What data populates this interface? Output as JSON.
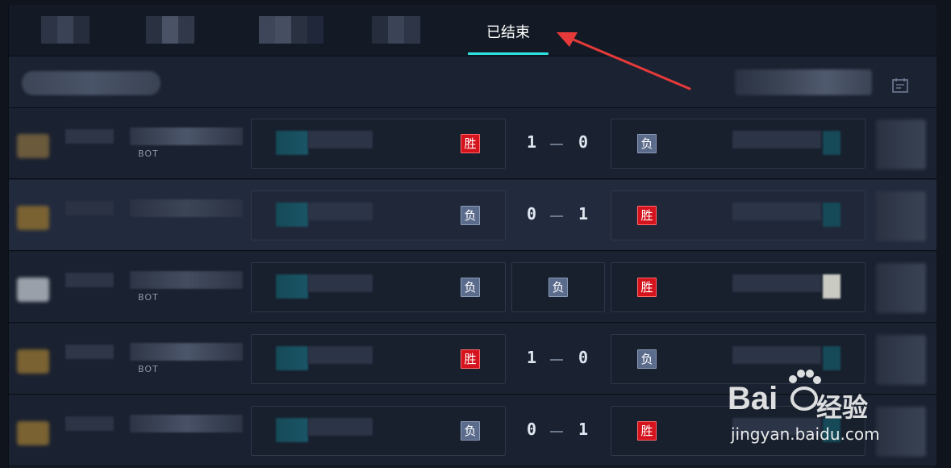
{
  "tabs": {
    "active_label": "已结束"
  },
  "matches": [
    {
      "left_result": "胜",
      "score_left": "1",
      "score_right": "0",
      "right_result": "负",
      "tag_left": "BOT",
      "show_score": true
    },
    {
      "left_result": "负",
      "score_left": "0",
      "score_right": "1",
      "right_result": "胜",
      "tag_left": "",
      "show_score": true
    },
    {
      "left_result": "负",
      "center_result": "负",
      "right_result": "胜",
      "tag_left": "BOT",
      "show_score": false
    },
    {
      "left_result": "胜",
      "score_left": "1",
      "score_right": "0",
      "right_result": "负",
      "tag_left": "BOT",
      "show_score": true
    },
    {
      "left_result": "负",
      "score_left": "0",
      "score_right": "1",
      "right_result": "胜",
      "tag_left": "",
      "show_score": true
    }
  ],
  "watermark": {
    "brand": "Bai",
    "brand_cn": "经验",
    "url": "jingyan.baidu.com"
  },
  "colors": {
    "accent": "#2ee6e4",
    "win": "#d4131d",
    "lose": "#5b6b8b",
    "arrow": "#e63a3a"
  },
  "icons": [
    "calendar-icon",
    "annotation-arrow",
    "baidu-paw-icon"
  ]
}
